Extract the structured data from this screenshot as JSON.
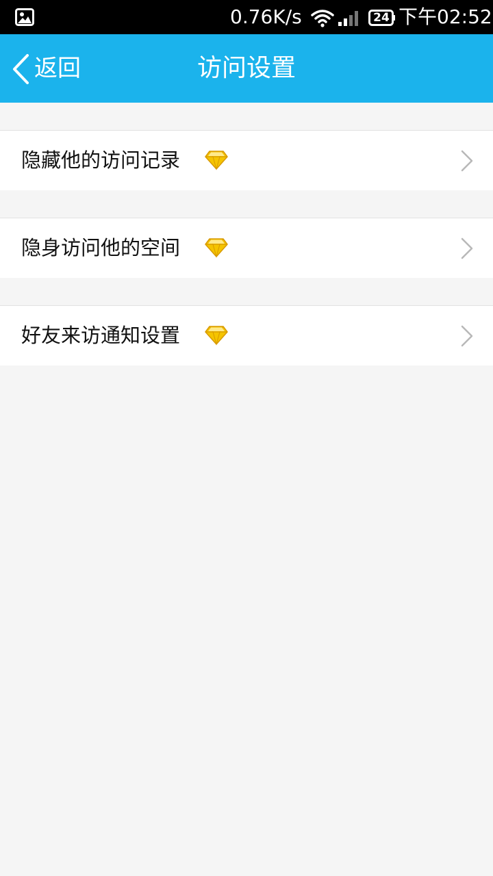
{
  "status_bar": {
    "network_speed": "0.76K/s",
    "battery_level": "24",
    "time": "下午02:52"
  },
  "header": {
    "back_label": "返回",
    "title": "访问设置"
  },
  "settings": {
    "items": [
      {
        "label": "隐藏他的访问记录",
        "badge_icon": "diamond-icon"
      },
      {
        "label": "隐身访问他的空间",
        "badge_icon": "diamond-icon"
      },
      {
        "label": "好友来访通知设置",
        "badge_icon": "diamond-icon"
      }
    ]
  },
  "colors": {
    "header_background": "#1bb3ec",
    "page_background": "#f5f5f5",
    "diamond": "#f5c400"
  }
}
